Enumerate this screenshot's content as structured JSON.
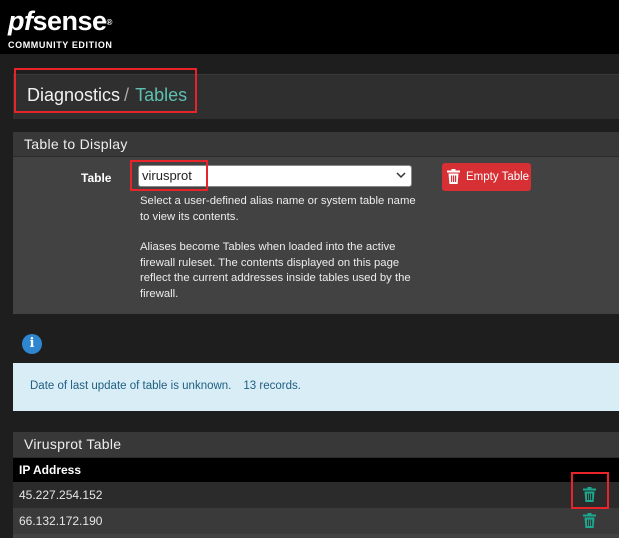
{
  "brand": {
    "logo_pf": "pf",
    "logo_sense": "sense",
    "logo_reg": "®",
    "edition": "COMMUNITY EDITION"
  },
  "breadcrumb": {
    "section": "Diagnostics",
    "separator": "/",
    "page": "Tables"
  },
  "table_panel": {
    "title": "Table to Display",
    "field_label": "Table",
    "selected_table": "virusprot",
    "help_1": "Select a user-defined alias name or system table name to view its contents.",
    "help_2": "Aliases become Tables when loaded into the active firewall ruleset. The contents displayed on this page reflect the current addresses inside tables used by the firewall.",
    "empty_button": "Empty Table"
  },
  "info": {
    "icon": "info-icon",
    "last_update": "Date of last update of table is unknown.",
    "records": "13 records."
  },
  "results": {
    "title": "Virusprot Table",
    "column": "IP Address",
    "rows": [
      {
        "ip": "45.227.254.152"
      },
      {
        "ip": "66.132.172.190"
      }
    ]
  },
  "colors": {
    "accent": "#5ec0b2",
    "danger": "#d62f34",
    "trash": "#1aa88f",
    "highlight": "#e8242a"
  }
}
